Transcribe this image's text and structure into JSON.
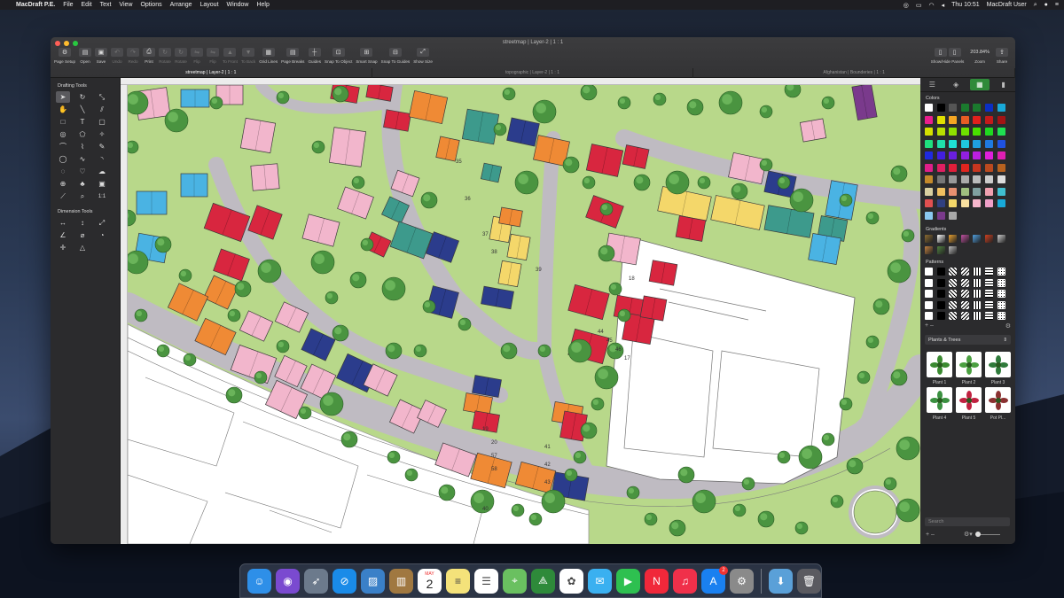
{
  "menubar": {
    "app": "MacDraft P.E.",
    "items": [
      "File",
      "Edit",
      "Text",
      "View",
      "Options",
      "Arrange",
      "Layout",
      "Window",
      "Help"
    ],
    "clock": "Thu 10:51",
    "user": "MacDraft User"
  },
  "window": {
    "title": "streetmap | Layer-2 | 1 : 1",
    "toolbar": [
      {
        "label": "Page Setup",
        "icon": "gear-icon",
        "enabled": true
      },
      {
        "label": "Open",
        "icon": "folder-icon",
        "enabled": true
      },
      {
        "label": "Save",
        "icon": "save-icon",
        "enabled": true
      },
      {
        "label": "Undo",
        "icon": "undo-icon",
        "enabled": false
      },
      {
        "label": "Redo",
        "icon": "redo-icon",
        "enabled": false
      },
      {
        "label": "Print",
        "icon": "print-icon",
        "enabled": true
      },
      {
        "label": "Rotate",
        "icon": "rotate-icon",
        "enabled": false
      },
      {
        "label": "Rotate",
        "icon": "rotate-icon",
        "enabled": false
      },
      {
        "label": "Flip",
        "icon": "flip-icon",
        "enabled": false
      },
      {
        "label": "Flip",
        "icon": "flip-icon",
        "enabled": false
      },
      {
        "label": "To Front",
        "icon": "to-front-icon",
        "enabled": false
      },
      {
        "label": "To Back",
        "icon": "to-back-icon",
        "enabled": false
      },
      {
        "label": "Grid Lines",
        "icon": "grid-icon",
        "enabled": true
      },
      {
        "label": "Page Breaks",
        "icon": "page-breaks-icon",
        "enabled": true
      },
      {
        "label": "Guides",
        "icon": "guides-icon",
        "enabled": true
      },
      {
        "label": "Snap To Object",
        "icon": "snap-object-icon",
        "enabled": true
      },
      {
        "label": "Smart Snap",
        "icon": "smart-snap-icon",
        "enabled": true
      },
      {
        "label": "Snap To Guides",
        "icon": "snap-guides-icon",
        "enabled": true
      },
      {
        "label": "Show Size",
        "icon": "show-size-icon",
        "enabled": true
      }
    ],
    "show_hide_panels": "Show/Hide Panels",
    "zoom_value": "203.84%",
    "zoom_label": "Zoom",
    "share_label": "Share",
    "tabs": [
      {
        "label": "streetmap | Layer-2 | 1 : 1",
        "active": true
      },
      {
        "label": "topographic | Layer-2 | 1 : 1",
        "active": false
      },
      {
        "label": "Afghanistan | Bounderies | 1 : 1",
        "active": false
      }
    ]
  },
  "left_panel": {
    "drafting_title": "Drafting Tools",
    "drafting_tools": [
      "arrow",
      "rotate",
      "resize",
      "hand",
      "line",
      "parallel-line",
      "rectangle",
      "text",
      "rounded-rect",
      "circle",
      "polygon",
      "star",
      "arc",
      "curve",
      "bezier",
      "ellipse",
      "spline",
      "rounded-arc",
      "donut",
      "heart",
      "cloud",
      "crosshair",
      "tree",
      "image",
      "eyedropper",
      "zoom",
      "scale"
    ],
    "scale_label": "1:1",
    "dimension_title": "Dimension Tools",
    "dimension_tools": [
      "horizontal",
      "vertical",
      "diagonal",
      "angular",
      "diameter",
      "radius",
      "center",
      "area"
    ]
  },
  "map": {
    "plot_labels": [
      "35",
      "36",
      "37",
      "38",
      "39",
      "40",
      "41",
      "42",
      "43",
      "44",
      "45",
      "46",
      "17",
      "18",
      "19",
      "20",
      "57",
      "58"
    ],
    "colors": {
      "road": "#bfbbc2",
      "grass": "#b8d88a",
      "tree": "#4a9440",
      "pink": "#f2b6cc",
      "red": "#d8263f",
      "orange": "#ef8a35",
      "teal": "#3d9a8c",
      "navy": "#2b3c8c",
      "yellow": "#f4d76a",
      "blue": "#4ab3e3"
    }
  },
  "right_panel": {
    "colors_title": "Colors",
    "swatches": [
      "#ffffff",
      "#000000",
      "#555555",
      "#1b7a2e",
      "#1b7a2e",
      "#0b2fc4",
      "#18a9d8",
      "#e91e8c",
      "#e0e000",
      "#f5a623",
      "#e85d24",
      "#e0201c",
      "#c41a1a",
      "#a31414",
      "#d4e000",
      "#b8e000",
      "#8fe000",
      "#6fe000",
      "#49e000",
      "#20d920",
      "#1fe051",
      "#1fe07f",
      "#1fe0ab",
      "#1fe0d3",
      "#1fc7e0",
      "#1fa0e0",
      "#1f7ae0",
      "#1f52e0",
      "#1f2ae0",
      "#421fe0",
      "#6a1fe0",
      "#921fe0",
      "#bb1fe0",
      "#e01fdc",
      "#e01fb3",
      "#e01f8a",
      "#e01f62",
      "#e01f3a",
      "#e0251f",
      "#c7361f",
      "#bb4a1f",
      "#b8621f",
      "#c48a2b",
      "#777777",
      "#999999",
      "#aaaaaa",
      "#bbbbbb",
      "#cccccc",
      "#dddddd",
      "#d9d0a0",
      "#f0c060",
      "#e89070",
      "#a0c080",
      "#80a0a0",
      "#f0a0b0",
      "#40c0d0",
      "#e05050",
      "#304080",
      "#f4d76a",
      "#f9e0a0",
      "#f7b6cc",
      "#f0a0c8",
      "#18a9d8",
      "#8ac8f0",
      "#7a3a8c",
      "#a8a8a8"
    ],
    "gradients_title": "Gradients",
    "gradients": [
      "#8a6a30",
      "#ffffff",
      "#e8a030",
      "#c050a0",
      "#50a0e0",
      "#d04020",
      "#cccccc",
      "#c08040",
      "#508040",
      "#bbbbbb"
    ],
    "patterns_title": "Patterns",
    "library_select": "Plants & Trees",
    "plants": [
      "Plant 1",
      "Plant 2",
      "Plant 3",
      "Plant 4",
      "Plant 5",
      "Pot Pl..."
    ],
    "search_placeholder": "Search"
  },
  "dock": {
    "apps": [
      {
        "name": "Finder",
        "color": "#2e8fe8",
        "icon": "finder-icon"
      },
      {
        "name": "Siri",
        "color": "#7a4ad0",
        "icon": "siri-icon"
      },
      {
        "name": "Launchpad",
        "color": "#6c7a8c",
        "icon": "launchpad-icon"
      },
      {
        "name": "Safari",
        "color": "#1a8be8",
        "icon": "safari-icon"
      },
      {
        "name": "Preview",
        "color": "#3a80c8",
        "icon": "preview-icon"
      },
      {
        "name": "Notefile",
        "color": "#a07840",
        "icon": "notefile-icon"
      },
      {
        "name": "Calendar",
        "color": "#ffffff",
        "icon": "calendar-icon"
      },
      {
        "name": "Notes",
        "color": "#f4e27a",
        "icon": "notes-icon"
      },
      {
        "name": "Reminders",
        "color": "#ffffff",
        "icon": "reminders-icon"
      },
      {
        "name": "Maps",
        "color": "#6ac060",
        "icon": "maps-icon"
      },
      {
        "name": "MacDraft",
        "color": "#2e8a3a",
        "icon": "macdraft-icon"
      },
      {
        "name": "Photos",
        "color": "#ffffff",
        "icon": "photos-icon"
      },
      {
        "name": "Messages",
        "color": "#3ab0f0",
        "icon": "messages-icon"
      },
      {
        "name": "FaceTime",
        "color": "#2ec050",
        "icon": "facetime-icon"
      },
      {
        "name": "News",
        "color": "#f0283a",
        "icon": "news-icon"
      },
      {
        "name": "Music",
        "color": "#f0304a",
        "icon": "music-icon"
      },
      {
        "name": "App Store",
        "color": "#1a80f0",
        "icon": "appstore-icon",
        "badge": "2"
      },
      {
        "name": "System Preferences",
        "color": "#8a8a8a",
        "icon": "settings-icon"
      },
      {
        "name": "Downloads",
        "color": "#5aa0d8",
        "icon": "downloads-folder-icon"
      },
      {
        "name": "Trash",
        "color": "#5a5a60",
        "icon": "trash-icon"
      }
    ],
    "calendar_month": "MAY",
    "calendar_day": "2"
  }
}
